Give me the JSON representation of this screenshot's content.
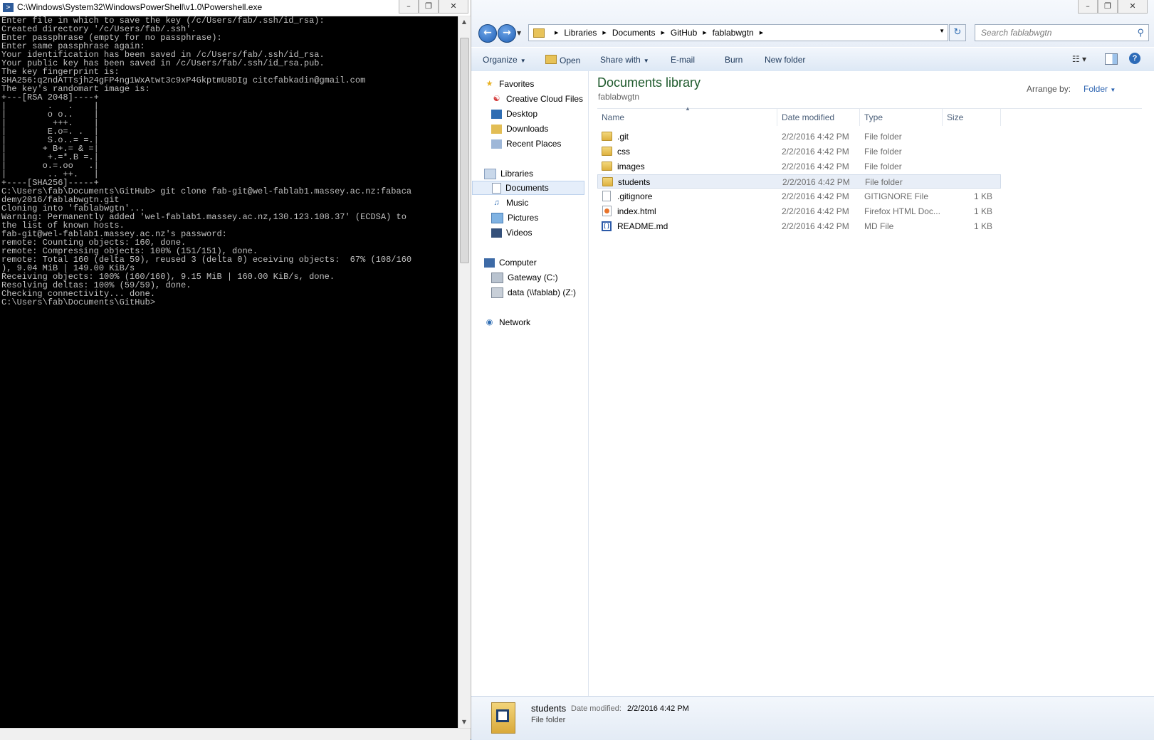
{
  "powershell": {
    "title": "C:\\Windows\\System32\\WindowsPowerShell\\v1.0\\Powershell.exe",
    "lines": [
      "Enter file in which to save the key (/c/Users/fab/.ssh/id_rsa):",
      "Created directory '/c/Users/fab/.ssh'.",
      "Enter passphrase (empty for no passphrase):",
      "Enter same passphrase again:",
      "Your identification has been saved in /c/Users/fab/.ssh/id_rsa.",
      "Your public key has been saved in /c/Users/fab/.ssh/id_rsa.pub.",
      "The key fingerprint is:",
      "SHA256:q2ndATTsjh24gFP4ng1WxAtwt3c9xP4GkptmU8DIg citcfabkadin@gmail.com",
      "The key's randomart image is:",
      "+---[RSA 2048]----+",
      "|        .   .    |",
      "|        o o..    |",
      "|         +++.    |",
      "|        E.o=. .  |",
      "|        S.o..= =.|",
      "|       + B+.= & =|",
      "|        +.=*.B =.|",
      "|       o.=.oo   .|",
      "|        .. ++.   |",
      "+----[SHA256]-----+",
      "C:\\Users\\fab\\Documents\\GitHub> git clone fab-git@wel-fablab1.massey.ac.nz:fabaca",
      "demy2016/fablabwgtn.git",
      "Cloning into 'fablabwgtn'...",
      "Warning: Permanently added 'wel-fablab1.massey.ac.nz,130.123.108.37' (ECDSA) to",
      "the list of known hosts.",
      "fab-git@wel-fablab1.massey.ac.nz's password:",
      "remote: Counting objects: 160, done.",
      "remote: Compressing objects: 100% (151/151), done.",
      "remote: Total 160 (delta 59), reused 3 (delta 0) eceiving objects:  67% (108/160",
      "), 9.04 MiB | 149.00 KiB/s",
      "Receiving objects: 100% (160/160), 9.15 MiB | 160.00 KiB/s, done.",
      "Resolving deltas: 100% (59/59), done.",
      "Checking connectivity... done.",
      "C:\\Users\\fab\\Documents\\GitHub>"
    ]
  },
  "explorer": {
    "address": [
      "Libraries",
      "Documents",
      "GitHub",
      "fablabwgtn"
    ],
    "search_placeholder": "Search fablabwgtn",
    "commands": {
      "organize": "Organize",
      "open": "Open",
      "share_with": "Share with",
      "email": "E-mail",
      "burn": "Burn",
      "new_folder": "New folder"
    },
    "nav": {
      "favorites": "Favorites",
      "creative_cloud": "Creative Cloud Files",
      "desktop": "Desktop",
      "downloads": "Downloads",
      "recent_places": "Recent Places",
      "libraries": "Libraries",
      "documents": "Documents",
      "music": "Music",
      "pictures": "Pictures",
      "videos": "Videos",
      "computer": "Computer",
      "gateway": "Gateway (C:)",
      "data_drive": "data (\\\\fablab) (Z:)",
      "network": "Network"
    },
    "library_title": "Documents library",
    "library_subtitle": "fablabwgtn",
    "arrange_label": "Arrange by:",
    "arrange_value": "Folder",
    "columns": {
      "name": "Name",
      "date": "Date modified",
      "type": "Type",
      "size": "Size"
    },
    "files": [
      {
        "name": ".git",
        "date": "2/2/2016 4:42 PM",
        "type": "File folder",
        "size": "",
        "icon": "folder-icon"
      },
      {
        "name": "css",
        "date": "2/2/2016 4:42 PM",
        "type": "File folder",
        "size": "",
        "icon": "folder-icon"
      },
      {
        "name": "images",
        "date": "2/2/2016 4:42 PM",
        "type": "File folder",
        "size": "",
        "icon": "folder-icon"
      },
      {
        "name": "students",
        "date": "2/2/2016 4:42 PM",
        "type": "File folder",
        "size": "",
        "icon": "folder-icon"
      },
      {
        "name": ".gitignore",
        "date": "2/2/2016 4:42 PM",
        "type": "GITIGNORE File",
        "size": "1 KB",
        "icon": "file-icon"
      },
      {
        "name": "index.html",
        "date": "2/2/2016 4:42 PM",
        "type": "Firefox HTML Doc...",
        "size": "1 KB",
        "icon": "firefox-html-icon"
      },
      {
        "name": "README.md",
        "date": "2/2/2016 4:42 PM",
        "type": "MD File",
        "size": "1 KB",
        "icon": "md-file-icon"
      }
    ],
    "details": {
      "name": "students",
      "date_label": "Date modified:",
      "date_value": "2/2/2016 4:42 PM",
      "type": "File folder"
    }
  }
}
